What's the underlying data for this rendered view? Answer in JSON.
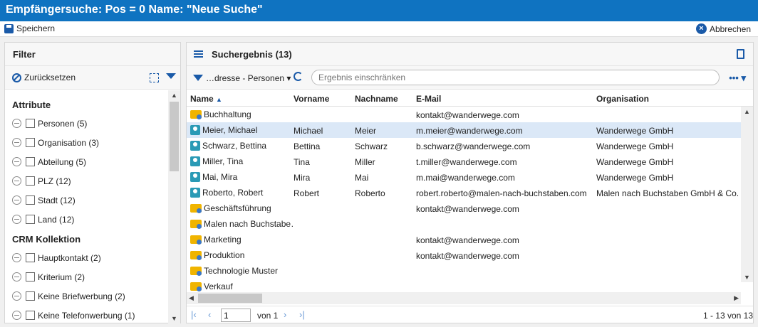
{
  "window": {
    "title": "Empfängersuche: Pos = 0 Name: \"Neue Suche\""
  },
  "toolbar": {
    "save_label": "Speichern",
    "cancel_label": "Abbrechen"
  },
  "filter": {
    "title": "Filter",
    "reset_label": "Zurücksetzen",
    "groups": [
      {
        "label": "Attribute",
        "items": [
          "Personen (5)",
          "Organisation (3)",
          "Abteilung (5)",
          "PLZ (12)",
          "Stadt (12)",
          "Land (12)"
        ]
      },
      {
        "label": "CRM Kollektion",
        "items": [
          "Hauptkontakt (2)",
          "Kriterium (2)",
          "Keine Briefwerbung (2)",
          "Keine Telefonwerbung (1)"
        ]
      }
    ]
  },
  "result": {
    "title": "Suchergebnis (13)",
    "dropdown_label": "…dresse - Personen",
    "search_placeholder": "Ergebnis einschränken",
    "more_label": "•••",
    "columns": [
      "Name",
      "Vorname",
      "Nachname",
      "E-Mail",
      "Organisation"
    ],
    "rows": [
      {
        "icon": "folder",
        "name": "Buchhaltung",
        "vorname": "",
        "nachname": "",
        "email": "kontakt@wanderwege.com",
        "org": ""
      },
      {
        "icon": "person",
        "name": "Meier, Michael",
        "vorname": "Michael",
        "nachname": "Meier",
        "email": "m.meier@wanderwege.com",
        "org": "Wanderwege GmbH",
        "selected": true
      },
      {
        "icon": "person",
        "name": "Schwarz, Bettina",
        "vorname": "Bettina",
        "nachname": "Schwarz",
        "email": "b.schwarz@wanderwege.com",
        "org": "Wanderwege GmbH"
      },
      {
        "icon": "person",
        "name": "Miller, Tina",
        "vorname": "Tina",
        "nachname": "Miller",
        "email": "t.miller@wanderwege.com",
        "org": "Wanderwege GmbH"
      },
      {
        "icon": "person",
        "name": "Mai, Mira",
        "vorname": "Mira",
        "nachname": "Mai",
        "email": "m.mai@wanderwege.com",
        "org": "Wanderwege GmbH"
      },
      {
        "icon": "person",
        "name": "Roberto, Robert",
        "vorname": "Robert",
        "nachname": "Roberto",
        "email": "robert.roberto@malen-nach-buchstaben.com",
        "org": "Malen nach Buchstaben GmbH & Co. Kg"
      },
      {
        "icon": "folder",
        "name": "Geschäftsführung",
        "vorname": "",
        "nachname": "",
        "email": "kontakt@wanderwege.com",
        "org": ""
      },
      {
        "icon": "folder",
        "name": "Malen nach Buchstabe…",
        "vorname": "",
        "nachname": "",
        "email": "",
        "org": ""
      },
      {
        "icon": "folder",
        "name": "Marketing",
        "vorname": "",
        "nachname": "",
        "email": "kontakt@wanderwege.com",
        "org": ""
      },
      {
        "icon": "folder",
        "name": "Produktion",
        "vorname": "",
        "nachname": "",
        "email": "kontakt@wanderwege.com",
        "org": ""
      },
      {
        "icon": "folder",
        "name": "Technologie Muster",
        "vorname": "",
        "nachname": "",
        "email": "",
        "org": ""
      },
      {
        "icon": "folder",
        "name": "Verkauf",
        "vorname": "",
        "nachname": "",
        "email": "",
        "org": ""
      }
    ],
    "pager": {
      "page": "1",
      "of_label": "von 1",
      "count_label": "1 - 13 von 13"
    }
  },
  "colors": {
    "titlebar": "#0f73c1",
    "accent": "#1a5aa8",
    "selected_row": "#dbe8f7"
  }
}
